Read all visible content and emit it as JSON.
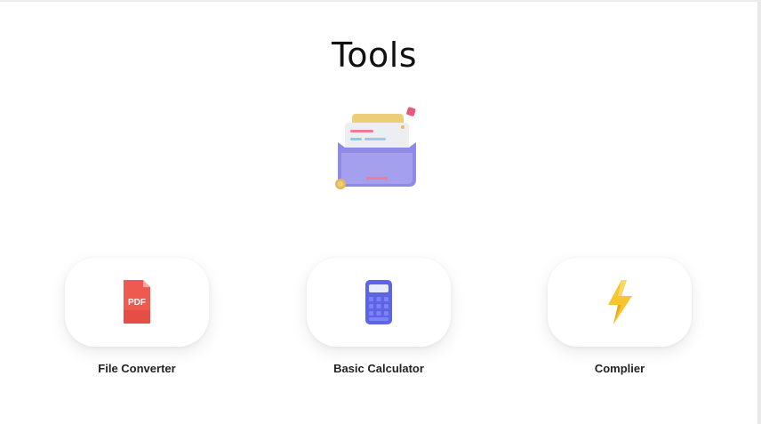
{
  "page": {
    "title": "Tools",
    "hero_icon": "file-drawer-icon"
  },
  "tools": [
    {
      "label": "File Converter",
      "icon": "pdf-file-icon",
      "icon_text": "PDF",
      "color": "#f0564f"
    },
    {
      "label": "Basic Calculator",
      "icon": "calculator-icon",
      "color": "#5b63e6"
    },
    {
      "label": "Complier",
      "icon": "lightning-bolt-icon",
      "color": "#f7c62f"
    }
  ]
}
